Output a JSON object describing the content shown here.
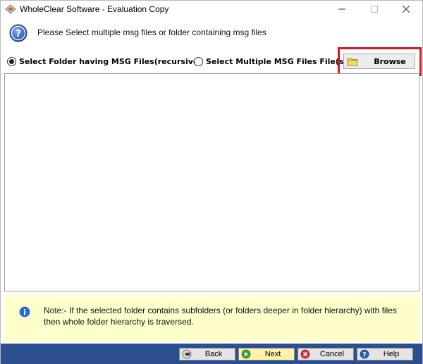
{
  "window": {
    "title": "WholeClear Software - Evaluation Copy"
  },
  "header": {
    "message": "Please Select multiple msg files or folder containing msg files"
  },
  "options": {
    "folder_label": "Select Folder having MSG Files(recursive)",
    "files_label": "Select Multiple MSG Files File(s)",
    "selected": "folder"
  },
  "browse": {
    "label": "Browse"
  },
  "note": {
    "text": "Note:- If the selected folder contains subfolders (or folders deeper in folder hierarchy) with files then whole folder hierarchy is traversed."
  },
  "nav": {
    "back_label": "Back",
    "next_label": "Next",
    "cancel_label": "Cancel",
    "help_label": "Help"
  },
  "colors": {
    "bottom_bar": "#2b4f8f",
    "note_background": "#ffffcc",
    "highlight": "#d51a2a",
    "next_button": "#fff2a8"
  },
  "icons": {
    "app": "app-logo-icon",
    "header": "question-circle-icon",
    "browse": "folder-icon",
    "note": "info-icon",
    "back": "back-arrow-icon",
    "next": "next-arrow-icon",
    "cancel": "cancel-icon",
    "help": "help-icon"
  }
}
